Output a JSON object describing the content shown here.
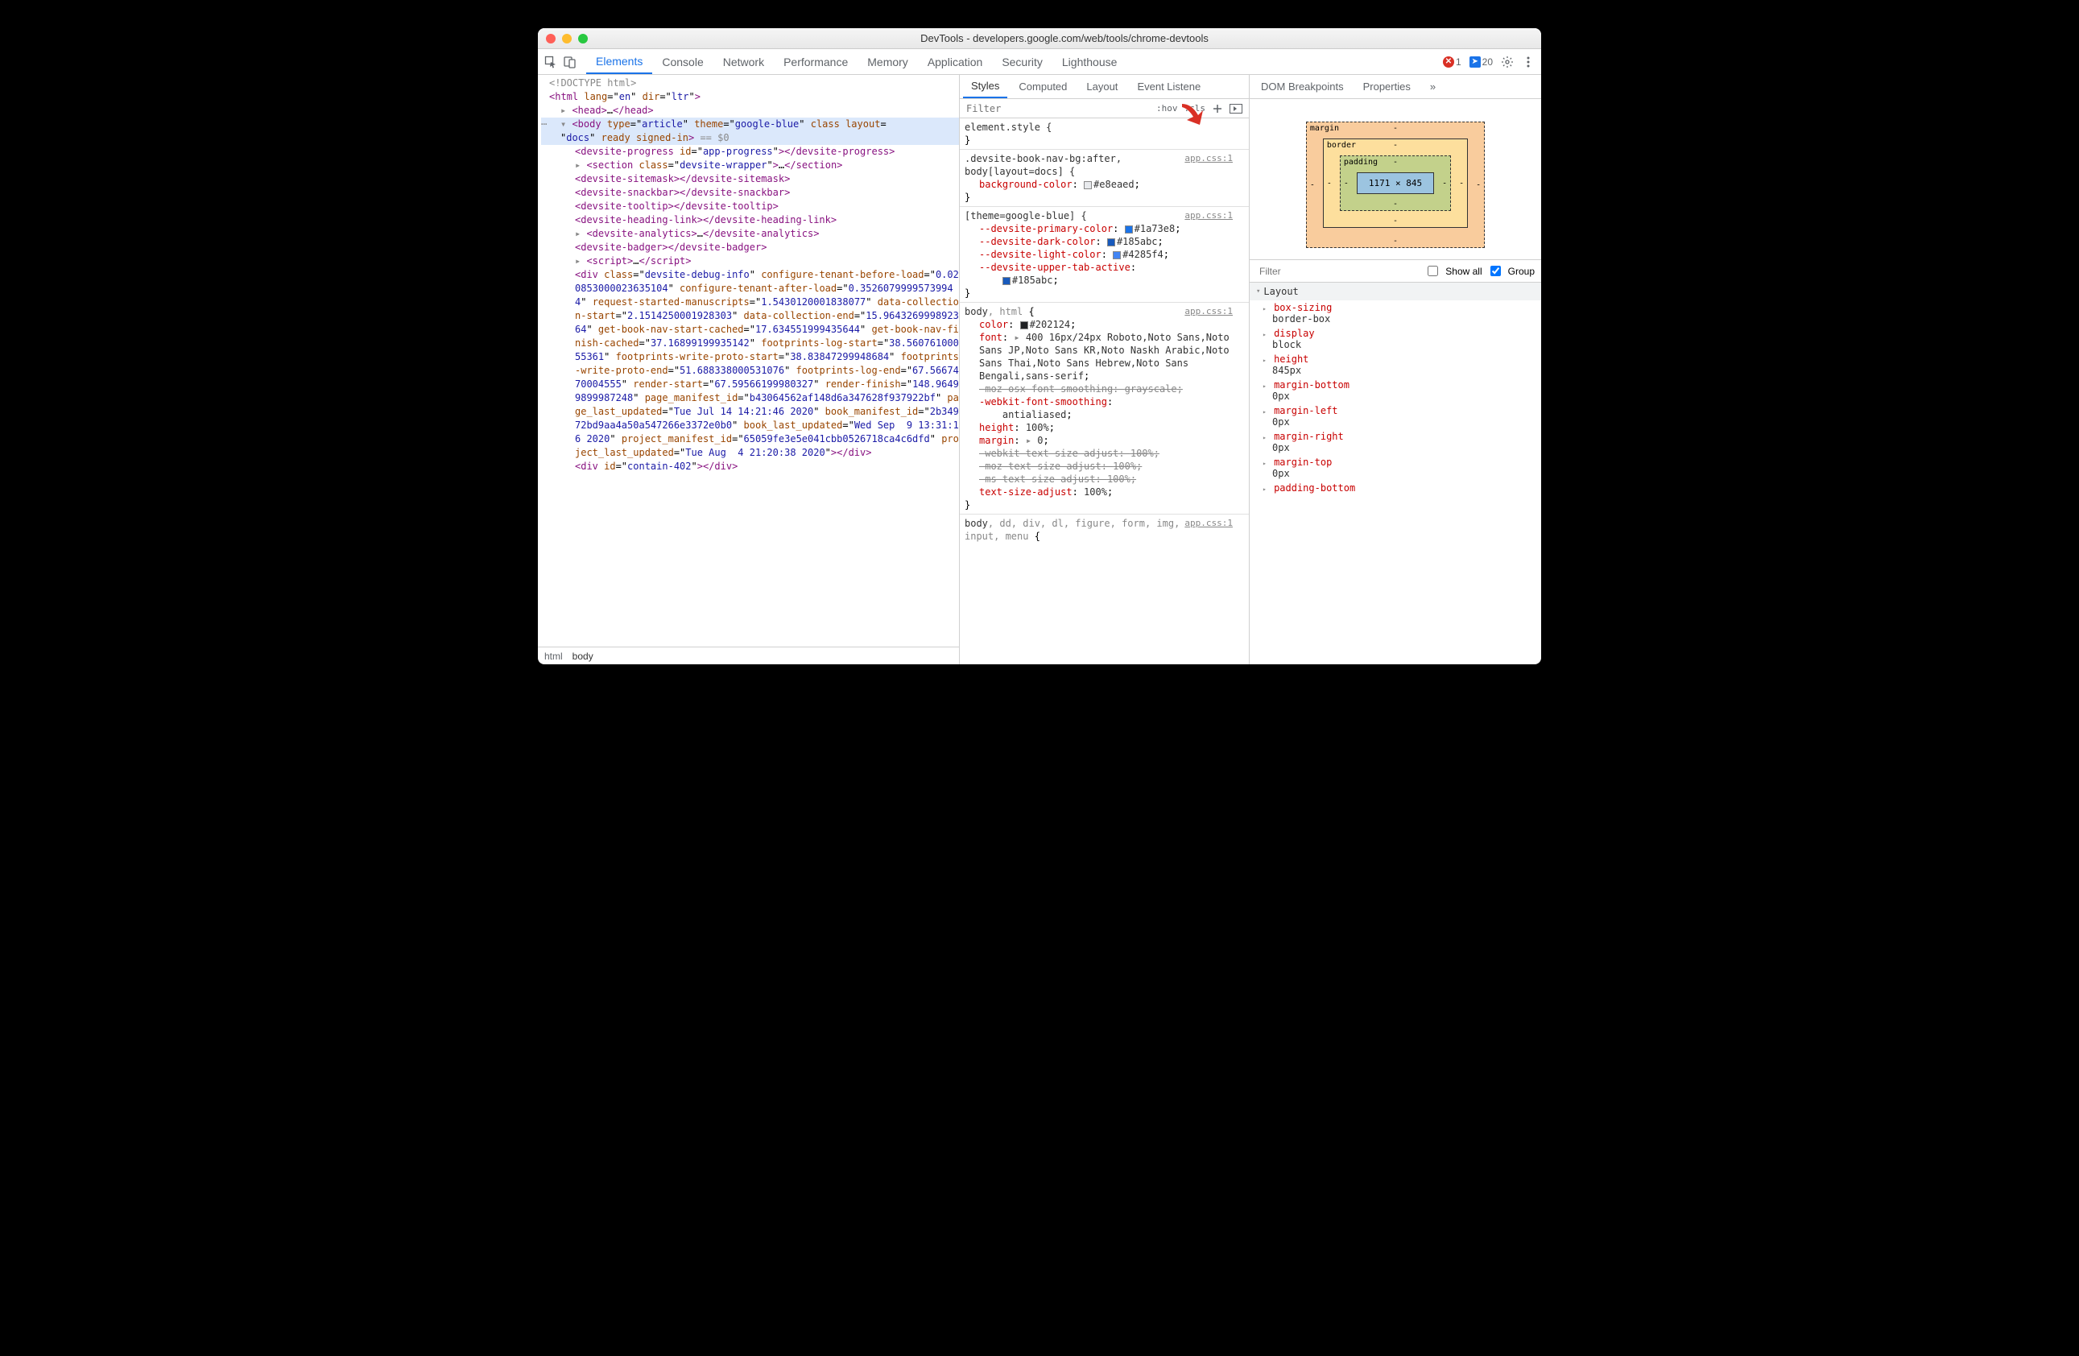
{
  "window": {
    "title": "DevTools - developers.google.com/web/tools/chrome-devtools"
  },
  "main_tabs": {
    "items": [
      "Elements",
      "Console",
      "Network",
      "Performance",
      "Memory",
      "Application",
      "Security",
      "Lighthouse"
    ],
    "active": "Elements",
    "errors": "1",
    "messages": "20"
  },
  "dom": {
    "line0": "<!DOCTYPE html>",
    "line1_open": "<html lang=\"en\" dir=\"ltr\">",
    "line_head": "<head>…</head>",
    "body_open_a": "<body type=\"article\" theme=\"google-blue\" class layout=",
    "body_open_b": "\"docs\" ready signed-in> == $0",
    "progress": "<devsite-progress id=\"app-progress\"></devsite-progress>",
    "section": "<section class=\"devsite-wrapper\">…</section>",
    "sitemask": "<devsite-sitemask></devsite-sitemask>",
    "snackbar": "<devsite-snackbar></devsite-snackbar>",
    "tooltip": "<devsite-tooltip></devsite-tooltip>",
    "headinglink": "<devsite-heading-link></devsite-heading-link>",
    "analytics": "<devsite-analytics>…</devsite-analytics>",
    "badger": "<devsite-badger></devsite-badger>",
    "scriptl": "<script>…</script>",
    "debugdiv": "<div class=\"devsite-debug-info\" configure-tenant-before-load=\"0.020853000023635104\" configure-tenant-after-load=\"0.35260799995739944\" request-started-manuscripts=\"1.5430120001838077\" data-collection-start=\"2.1514250001928303\" data-collection-end=\"15.964326999892364\" get-book-nav-start-cached=\"17.634551999435644\" get-book-nav-finish-cached=\"37.16899199935142\" footprints-log-start=\"38.56076100055361\" footprints-write-proto-start=\"38.83847299948684\" footprints-write-proto-end=\"51.688338000531076\" footprints-log-end=\"67.5667470004555\" render-start=\"67.59566199980327\" render-finish=\"148.96499899987248\" page_manifest_id=\"b43064562af148d6a347628f937922bf\" page_last_updated=\"Tue Jul 14 14:21:46 2020\" book_manifest_id=\"2b34972bd9aa4a50a547266e3372e0b0\" book_last_updated=\"Wed Sep  9 13:31:16 2020\" project_manifest_id=\"65059fe3e5e041cbb0526718ca4c6dfd\" project_last_updated=\"Tue Aug  4 21:20:38 2020\"></div>",
    "contain": "<div id=\"contain-402\"></div>"
  },
  "breadcrumb": {
    "a": "html",
    "b": "body"
  },
  "styles": {
    "sub_tabs": [
      "Styles",
      "Computed",
      "Layout",
      "Event Listeners",
      "DOM Breakpoints",
      "Properties"
    ],
    "filter_placeholder": "Filter",
    "hov": ":hov",
    "cls": ".cls",
    "r_element": "element.style {",
    "r_close": "}",
    "r2_sel": ".devsite-book-nav-bg:after, body[layout=docs] {",
    "r2_src": "app.css:1",
    "r2_p1": "background-color",
    "r2_v1": "#e8eaed",
    "r3_sel": "[theme=google-blue] {",
    "r3_src": "app.css:1",
    "r3_p1": "--devsite-primary-color",
    "r3_v1": "#1a73e8",
    "r3_p2": "--devsite-dark-color",
    "r3_v2": "#185abc",
    "r3_p3": "--devsite-light-color",
    "r3_v3": "#4285f4",
    "r3_p4": "--devsite-upper-tab-active",
    "r3_v4": "#185abc",
    "r4_sel": "body, html {",
    "r4_src": "app.css:1",
    "r4_p1": "color",
    "r4_v1": "#202124",
    "r4_p2": "font",
    "r4_v2": "400 16px/24px Roboto,Noto Sans,Noto Sans JP,Noto Sans KR,Noto Naskh Arabic,Noto Sans Thai,Noto Sans Hebrew,Noto Sans Bengali,sans-serif",
    "r4_p3": "-moz-osx-font-smoothing",
    "r4_v3": "grayscale",
    "r4_p4": "-webkit-font-smoothing",
    "r4_v4": "antialiased",
    "r4_p5": "height",
    "r4_v5": "100%",
    "r4_p6": "margin",
    "r4_v6": "0",
    "r4_p7": "-webkit-text-size-adjust",
    "r4_v7": "100%",
    "r4_p8": "-moz-text-size-adjust",
    "r4_v8": "100%",
    "r4_p9": "-ms-text-size-adjust",
    "r4_v9": "100%",
    "r4_p10": "text-size-adjust",
    "r4_v10": "100%",
    "r5_sel": "body, dd, div, dl, figure, form, img, input, menu {",
    "r5_src": "app.css:1"
  },
  "computed": {
    "box_dim": "1171 × 845",
    "margin_label": "margin",
    "border_label": "border",
    "padding_label": "padding",
    "dash": "-",
    "filter_placeholder": "Filter",
    "show_all": "Show all",
    "group": "Group",
    "header": "Layout",
    "props": [
      {
        "n": "box-sizing",
        "v": "border-box"
      },
      {
        "n": "display",
        "v": "block"
      },
      {
        "n": "height",
        "v": "845px"
      },
      {
        "n": "margin-bottom",
        "v": "0px"
      },
      {
        "n": "margin-left",
        "v": "0px"
      },
      {
        "n": "margin-right",
        "v": "0px"
      },
      {
        "n": "margin-top",
        "v": "0px"
      },
      {
        "n": "padding-bottom",
        "v": ""
      }
    ]
  }
}
